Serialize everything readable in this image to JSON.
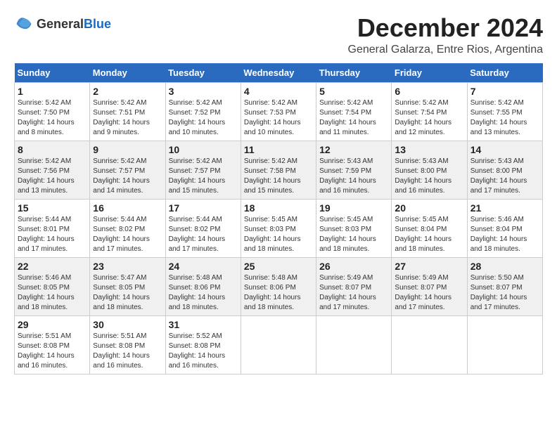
{
  "header": {
    "logo_general": "General",
    "logo_blue": "Blue",
    "month": "December 2024",
    "location": "General Galarza, Entre Rios, Argentina"
  },
  "weekdays": [
    "Sunday",
    "Monday",
    "Tuesday",
    "Wednesday",
    "Thursday",
    "Friday",
    "Saturday"
  ],
  "weeks": [
    [
      {
        "day": "1",
        "sunrise": "5:42 AM",
        "sunset": "7:50 PM",
        "daylight": "14 hours and 8 minutes."
      },
      {
        "day": "2",
        "sunrise": "5:42 AM",
        "sunset": "7:51 PM",
        "daylight": "14 hours and 9 minutes."
      },
      {
        "day": "3",
        "sunrise": "5:42 AM",
        "sunset": "7:52 PM",
        "daylight": "14 hours and 10 minutes."
      },
      {
        "day": "4",
        "sunrise": "5:42 AM",
        "sunset": "7:53 PM",
        "daylight": "14 hours and 10 minutes."
      },
      {
        "day": "5",
        "sunrise": "5:42 AM",
        "sunset": "7:54 PM",
        "daylight": "14 hours and 11 minutes."
      },
      {
        "day": "6",
        "sunrise": "5:42 AM",
        "sunset": "7:54 PM",
        "daylight": "14 hours and 12 minutes."
      },
      {
        "day": "7",
        "sunrise": "5:42 AM",
        "sunset": "7:55 PM",
        "daylight": "14 hours and 13 minutes."
      }
    ],
    [
      {
        "day": "8",
        "sunrise": "5:42 AM",
        "sunset": "7:56 PM",
        "daylight": "14 hours and 13 minutes."
      },
      {
        "day": "9",
        "sunrise": "5:42 AM",
        "sunset": "7:57 PM",
        "daylight": "14 hours and 14 minutes."
      },
      {
        "day": "10",
        "sunrise": "5:42 AM",
        "sunset": "7:57 PM",
        "daylight": "14 hours and 15 minutes."
      },
      {
        "day": "11",
        "sunrise": "5:42 AM",
        "sunset": "7:58 PM",
        "daylight": "14 hours and 15 minutes."
      },
      {
        "day": "12",
        "sunrise": "5:43 AM",
        "sunset": "7:59 PM",
        "daylight": "14 hours and 16 minutes."
      },
      {
        "day": "13",
        "sunrise": "5:43 AM",
        "sunset": "8:00 PM",
        "daylight": "14 hours and 16 minutes."
      },
      {
        "day": "14",
        "sunrise": "5:43 AM",
        "sunset": "8:00 PM",
        "daylight": "14 hours and 17 minutes."
      }
    ],
    [
      {
        "day": "15",
        "sunrise": "5:44 AM",
        "sunset": "8:01 PM",
        "daylight": "14 hours and 17 minutes."
      },
      {
        "day": "16",
        "sunrise": "5:44 AM",
        "sunset": "8:02 PM",
        "daylight": "14 hours and 17 minutes."
      },
      {
        "day": "17",
        "sunrise": "5:44 AM",
        "sunset": "8:02 PM",
        "daylight": "14 hours and 17 minutes."
      },
      {
        "day": "18",
        "sunrise": "5:45 AM",
        "sunset": "8:03 PM",
        "daylight": "14 hours and 18 minutes."
      },
      {
        "day": "19",
        "sunrise": "5:45 AM",
        "sunset": "8:03 PM",
        "daylight": "14 hours and 18 minutes."
      },
      {
        "day": "20",
        "sunrise": "5:45 AM",
        "sunset": "8:04 PM",
        "daylight": "14 hours and 18 minutes."
      },
      {
        "day": "21",
        "sunrise": "5:46 AM",
        "sunset": "8:04 PM",
        "daylight": "14 hours and 18 minutes."
      }
    ],
    [
      {
        "day": "22",
        "sunrise": "5:46 AM",
        "sunset": "8:05 PM",
        "daylight": "14 hours and 18 minutes."
      },
      {
        "day": "23",
        "sunrise": "5:47 AM",
        "sunset": "8:05 PM",
        "daylight": "14 hours and 18 minutes."
      },
      {
        "day": "24",
        "sunrise": "5:48 AM",
        "sunset": "8:06 PM",
        "daylight": "14 hours and 18 minutes."
      },
      {
        "day": "25",
        "sunrise": "5:48 AM",
        "sunset": "8:06 PM",
        "daylight": "14 hours and 18 minutes."
      },
      {
        "day": "26",
        "sunrise": "5:49 AM",
        "sunset": "8:07 PM",
        "daylight": "14 hours and 17 minutes."
      },
      {
        "day": "27",
        "sunrise": "5:49 AM",
        "sunset": "8:07 PM",
        "daylight": "14 hours and 17 minutes."
      },
      {
        "day": "28",
        "sunrise": "5:50 AM",
        "sunset": "8:07 PM",
        "daylight": "14 hours and 17 minutes."
      }
    ],
    [
      {
        "day": "29",
        "sunrise": "5:51 AM",
        "sunset": "8:08 PM",
        "daylight": "14 hours and 16 minutes."
      },
      {
        "day": "30",
        "sunrise": "5:51 AM",
        "sunset": "8:08 PM",
        "daylight": "14 hours and 16 minutes."
      },
      {
        "day": "31",
        "sunrise": "5:52 AM",
        "sunset": "8:08 PM",
        "daylight": "14 hours and 16 minutes."
      },
      null,
      null,
      null,
      null
    ]
  ],
  "labels": {
    "sunrise": "Sunrise:",
    "sunset": "Sunset:",
    "daylight": "Daylight:"
  }
}
